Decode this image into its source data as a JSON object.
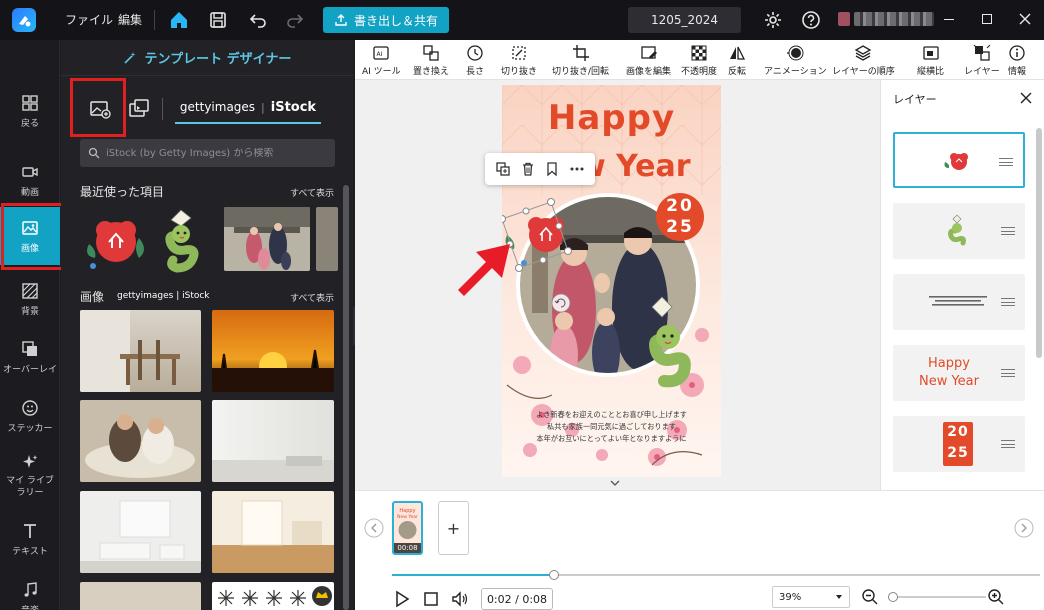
{
  "menu": {
    "file": "ファイル",
    "edit": "編集"
  },
  "export_label": "書き出し＆共有",
  "project_name": "1205_2024",
  "nav": {
    "back": "戻る",
    "video": "動画",
    "image": "画像",
    "background": "背景",
    "overlay": "オーバーレイ",
    "sticker": "ステッカー",
    "mylibrary": "マイ ライブラリー",
    "text": "テキスト",
    "music": "音楽"
  },
  "library": {
    "header": "テンプレート デザイナー",
    "provider_getty": "gettyimages",
    "provider_istock": "iStock",
    "search_placeholder": "iStock (by Getty Images) から検索",
    "recent_title": "最近使った項目",
    "show_all": "すべて表示",
    "images_title": "画像",
    "images_provider": "gettyimages | iStock"
  },
  "toolbar": {
    "ai_tool": "AI ツール",
    "replace": "置き換え",
    "length": "長さ",
    "cutout": "切り抜き",
    "crop_rotate": "切り抜き/回転",
    "edit_image": "画像を編集",
    "opacity": "不透明度",
    "flip": "反転",
    "animation": "アニメーション",
    "layer_order": "レイヤーの順序",
    "aspect": "縦横比",
    "layers": "レイヤー",
    "info": "情報"
  },
  "card": {
    "happy": "Happy",
    "new_year": "New Year",
    "year_top": "20",
    "year_bottom": "25",
    "greeting": [
      "よき新春をお迎えのこととお喜び申し上げます",
      "私共も家族一同元気に過ごしております",
      "本年がお互いにとってよい年となりますように"
    ]
  },
  "layers_panel": {
    "title": "レイヤー",
    "text_layer_1": "Happy",
    "text_layer_2": "New Year",
    "year_top": "20",
    "year_bottom": "25"
  },
  "timeline": {
    "clip_duration": "00:08",
    "timecode": "0:02 / 0:08",
    "zoom": "39%",
    "progress": 0.25
  },
  "colors": {
    "accent": "#11a2c4",
    "card_red": "#e24a2a",
    "highlight": "#e02020"
  }
}
